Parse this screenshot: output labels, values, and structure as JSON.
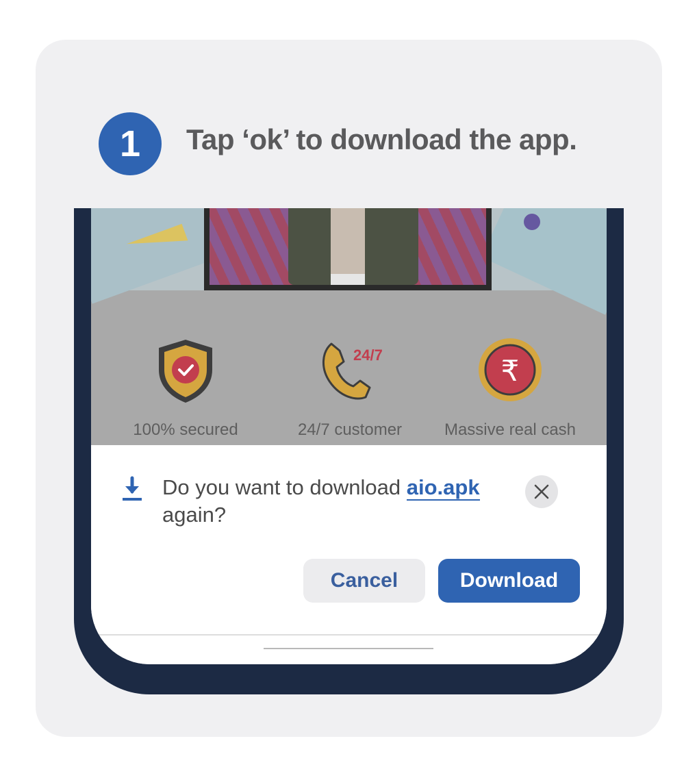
{
  "step": {
    "number": "1",
    "title": "Tap ‘ok’ to download the app."
  },
  "features": [
    {
      "icon": "shield-check-icon",
      "label": "100% secured"
    },
    {
      "icon": "phone-24-7-icon",
      "label": "24/7 customer",
      "badge": "24/7"
    },
    {
      "icon": "rupee-coin-icon",
      "label": "Massive real cash",
      "symbol": "₹"
    }
  ],
  "dialog": {
    "icon": "download-icon",
    "message_prefix": "Do you want to download ",
    "file_name": "aio.apk",
    "message_suffix": "again?",
    "close_icon": "close-icon",
    "cancel_label": "Cancel",
    "download_label": "Download"
  },
  "colors": {
    "accent": "#2f64b2",
    "phone_frame": "#1c2a44",
    "card_bg": "#f0f0f2"
  }
}
